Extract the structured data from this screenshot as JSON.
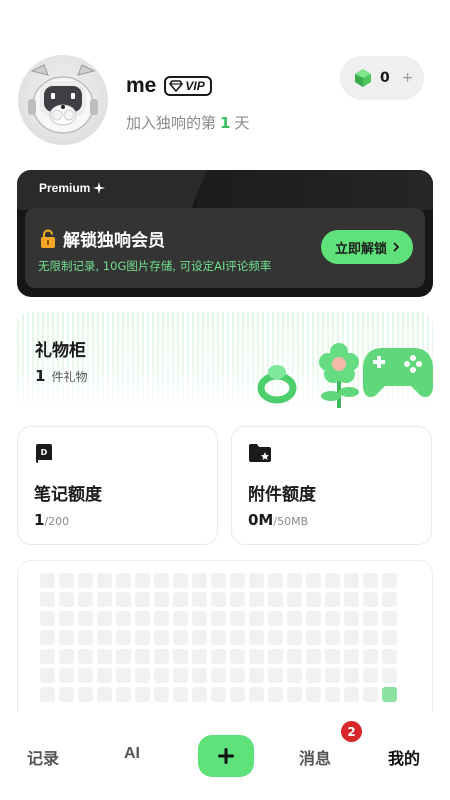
{
  "profile": {
    "username": "me",
    "vip_label": "VIP",
    "join_prefix": "加入独响的第",
    "join_days": "1",
    "join_suffix": "天",
    "gem_count": "0",
    "gem_plus": "+"
  },
  "premium": {
    "label": "Premium",
    "unlock_title": "解锁独响会员",
    "description": "无限制记录, 10G图片存储, 可设定AI评论频率",
    "unlock_button": "立即解锁"
  },
  "gift_cabinet": {
    "title": "礼物柜",
    "count": "1",
    "unit": "件礼物"
  },
  "quotas": {
    "notes": {
      "title": "笔记额度",
      "used": "1",
      "limit": "/200"
    },
    "attachments": {
      "title": "附件额度",
      "used": "0M",
      "limit": "/50MB"
    }
  },
  "heatmap": {
    "rows": 7,
    "cols": 19,
    "active_cells": [
      [
        6,
        18
      ]
    ],
    "active_color": "#8be39f",
    "empty_color": "#f1f1f1"
  },
  "nav": {
    "records": "记录",
    "ai": "AI",
    "messages": "消息",
    "messages_badge": "2",
    "mine": "我的"
  },
  "colors": {
    "accent": "#5fe27a",
    "accent_text": "#3bbf62",
    "badge": "#d8262b",
    "premium_bg": "#161616"
  }
}
